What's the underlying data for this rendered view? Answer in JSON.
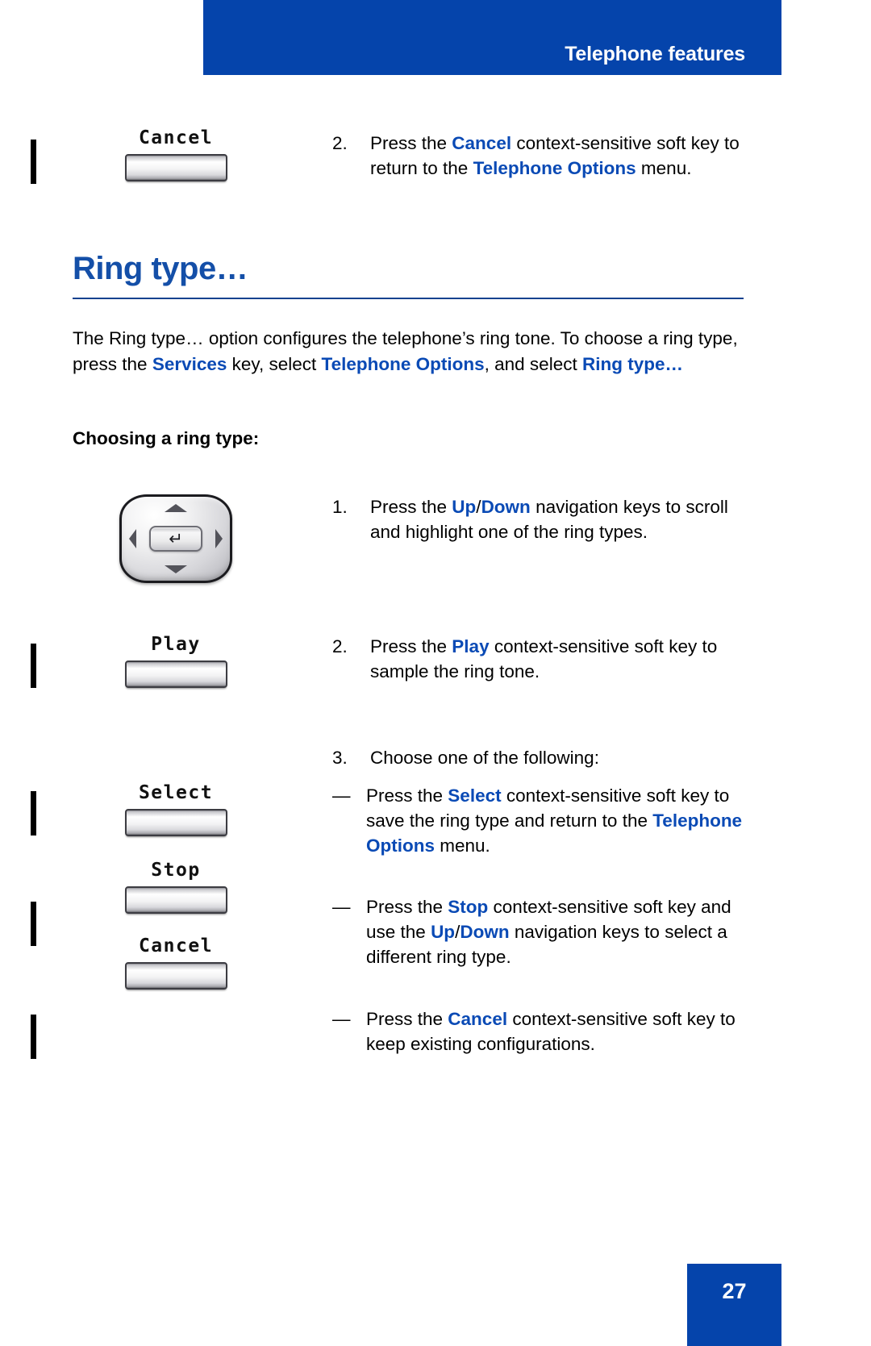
{
  "header": {
    "title": "Telephone features",
    "bar_color": "#0544ab"
  },
  "section": {
    "heading": "Ring type…",
    "heading_color": "#144fa8"
  },
  "intro": {
    "part1": "The Ring type… option configures the telephone’s ring tone. To choose a ring type, press the ",
    "bold1": "Services",
    "part2": " key, select ",
    "bold2": "Telephone Options",
    "part3": ", and select ",
    "bold3": "Ring type…"
  },
  "sub_heading": "Choosing a ring type:",
  "top_step": {
    "number": "2.",
    "part1": "Press the ",
    "bold1": "Cancel",
    "part2": " context-sensitive soft key to return to the ",
    "bold2": "Telephone Options",
    "part3": " menu.",
    "softkey_label": "Cancel"
  },
  "steps": [
    {
      "number": "1.",
      "part1": "Press the ",
      "bold1": "Up",
      "slash": "/",
      "bold2": "Down",
      "part2": " navigation keys to scroll and highlight one of the ring types.",
      "art": "navigation-cluster"
    },
    {
      "number": "2.",
      "part1": "Press the ",
      "bold1": "Play",
      "part2": " context-sensitive soft key to sample the ring tone.",
      "softkey_label": "Play"
    },
    {
      "number": "3.",
      "text": "Choose one of the following:"
    }
  ],
  "bullets": [
    {
      "dash": "—",
      "part1": "Press the ",
      "bold1": "Select",
      "part2": " context-sensitive soft key to save the ring type and return to the ",
      "bold2": "Telephone Options",
      "part3": " menu.",
      "softkey_label": "Select"
    },
    {
      "dash": "—",
      "part1": "Press the ",
      "bold1": "Stop",
      "part2": " context-sensitive soft key and use the ",
      "bold2": "Up",
      "slash": "/",
      "bold3": "Down",
      "part3": " navigation keys to select a different ring type.",
      "softkey_label": "Stop"
    },
    {
      "dash": "—",
      "part1": "Press the ",
      "bold1": "Cancel",
      "part2": " context-sensitive soft key to keep existing configurations.",
      "softkey_label": "Cancel"
    }
  ],
  "nav_icons": {
    "enter": "↵"
  },
  "footer": {
    "page_number": "27",
    "block_color": "#0544ab"
  }
}
